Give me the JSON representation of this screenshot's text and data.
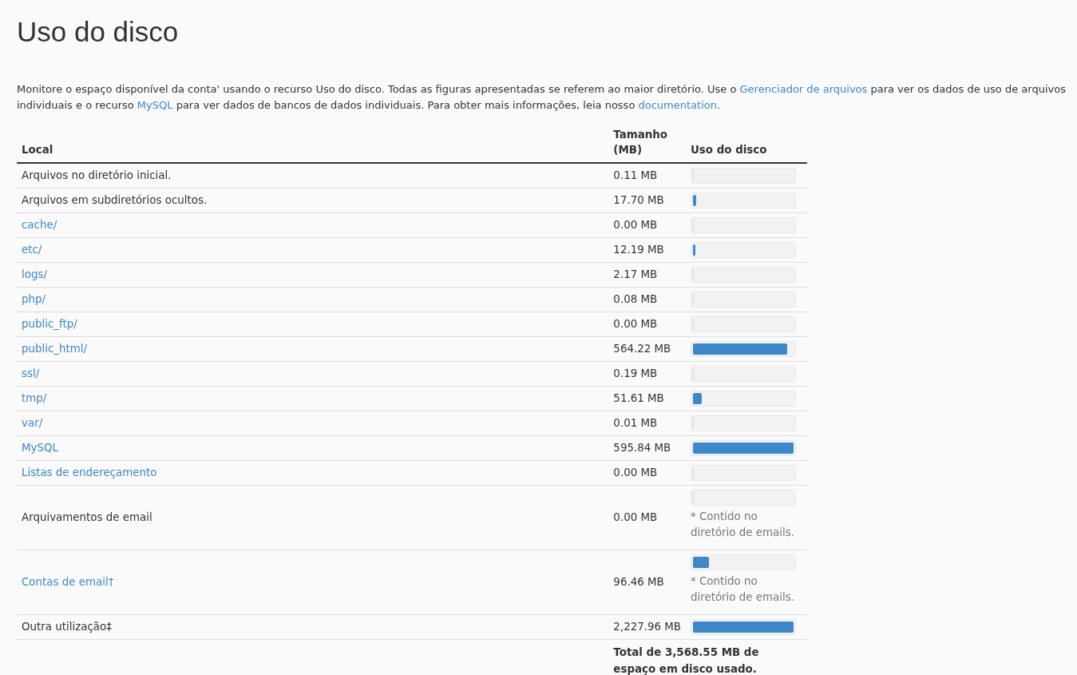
{
  "title": "Uso do disco",
  "description": [
    {
      "kind": "text",
      "text": "Monitore o espaço disponível da conta' usando o recurso Uso do disco. Todas as figuras apresentadas se referem ao maior diretório. Use o "
    },
    {
      "kind": "link",
      "text": "Gerenciador de arquivos"
    },
    {
      "kind": "text",
      "text": " para ver os dados de uso de arquivos individuais e o recurso "
    },
    {
      "kind": "link",
      "text": "MySQL"
    },
    {
      "kind": "text",
      "text": " para ver dados de bancos de dados individuais. Para obter mais informações, leia nosso "
    },
    {
      "kind": "link",
      "text": "documentation"
    },
    {
      "kind": "text",
      "text": "."
    }
  ],
  "table": {
    "columns": [
      "Local",
      "Tamanho (MB)",
      "Uso do disco"
    ],
    "rows": [
      {
        "kind": "text",
        "location": "Arquivos no diretório inicial.",
        "size": "0.11 MB",
        "level": 0
      },
      {
        "kind": "text",
        "location": "Arquivos em subdiretórios ocultos.",
        "size": "17.70 MB",
        "level": 0.03
      },
      {
        "kind": "link",
        "location": "cache/",
        "size": "0.00 MB",
        "level": 0
      },
      {
        "kind": "link",
        "location": "etc/",
        "size": "12.19 MB",
        "level": 0.02
      },
      {
        "kind": "link",
        "location": "logs/",
        "size": "2.17 MB",
        "level": 0
      },
      {
        "kind": "link",
        "location": "php/",
        "size": "0.08 MB",
        "level": 0
      },
      {
        "kind": "link",
        "location": "public_ftp/",
        "size": "0.00 MB",
        "level": 0
      },
      {
        "kind": "link",
        "location": "public_html/",
        "size": "564.22 MB",
        "level": 0.94
      },
      {
        "kind": "link",
        "location": "ssl/",
        "size": "0.19 MB",
        "level": 0
      },
      {
        "kind": "link",
        "location": "tmp/",
        "size": "51.61 MB",
        "level": 0.09
      },
      {
        "kind": "link",
        "location": "var/",
        "size": "0.01 MB",
        "level": 0
      },
      {
        "kind": "link",
        "location": "MySQL",
        "size": "595.84 MB",
        "level": 1
      },
      {
        "kind": "link",
        "location": "Listas de endereçamento",
        "size": "0.00 MB",
        "level": 0
      },
      {
        "kind": "text",
        "location": "Arquivamentos de email",
        "size": "0.00 MB",
        "level": 0,
        "note": "* Contido no diretório de emails."
      },
      {
        "kind": "link",
        "location": "Contas de email†",
        "size": "96.46 MB",
        "level": 0.16,
        "note": "* Contido no diretório de emails."
      },
      {
        "kind": "text",
        "location": "Outra utilização‡",
        "size": "2,227.96 MB",
        "level": 1
      }
    ],
    "total": "Total de 3,568.55 MB de espaço em disco usado."
  }
}
